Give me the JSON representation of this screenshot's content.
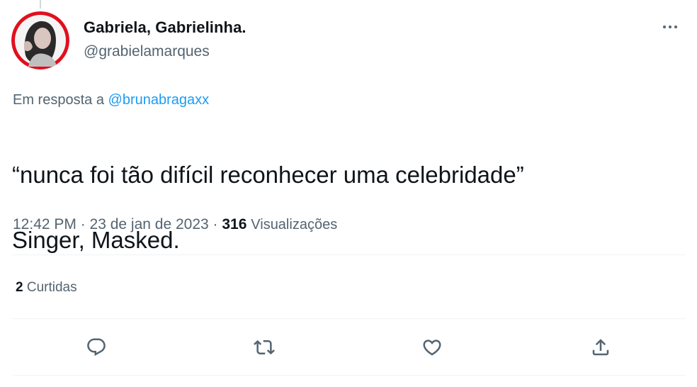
{
  "author": {
    "display_name": "Gabriela, Gabrielinha.",
    "handle": "@grabielamarques"
  },
  "reply": {
    "prefix": "Em resposta a",
    "mention": "@brunabragaxx"
  },
  "tweet": {
    "text_line1": "“nunca foi tão difícil reconhecer uma celebridade”",
    "text_line2": "Singer, Masked."
  },
  "meta": {
    "time_date": "12:42 PM · 23 de jan de 2023 · ",
    "views_count": "316",
    "views_label": "Visualizações"
  },
  "stats": {
    "likes_count": "2",
    "likes_label": "Curtidas"
  },
  "icons": {
    "more": "more-icon",
    "reply": "reply-icon",
    "retweet": "retweet-icon",
    "like": "like-icon",
    "share": "share-icon"
  },
  "colors": {
    "link": "#1d9bf0",
    "secondary_text": "#536471",
    "primary_text": "#0f1419",
    "divider": "#eff3f4"
  }
}
